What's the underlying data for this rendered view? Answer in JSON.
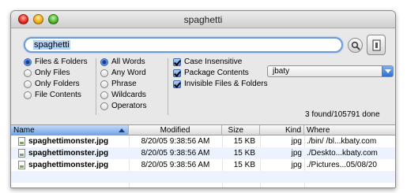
{
  "window": {
    "title": "spaghetti"
  },
  "search": {
    "query": "spaghetti"
  },
  "scope_options": [
    {
      "label": "Files & Folders",
      "selected": true
    },
    {
      "label": "Only Files",
      "selected": false
    },
    {
      "label": "Only Folders",
      "selected": false
    },
    {
      "label": "File Contents",
      "selected": false
    }
  ],
  "match_options": [
    {
      "label": "All Words",
      "selected": true
    },
    {
      "label": "Any Word",
      "selected": false
    },
    {
      "label": "Phrase",
      "selected": false
    },
    {
      "label": "Wildcards",
      "selected": false
    },
    {
      "label": "Operators",
      "selected": false
    }
  ],
  "flags": [
    {
      "label": "Case Insensitive",
      "checked": true
    },
    {
      "label": "Package Contents",
      "checked": true
    },
    {
      "label": "Invisible Files & Folders",
      "checked": true
    }
  ],
  "user_select": {
    "value": "jbaty"
  },
  "status": "3 found/105791 done",
  "table": {
    "columns": [
      "Name",
      "Modified",
      "Size",
      "Kind",
      "Where"
    ],
    "rows": [
      [
        "spaghettimonster.jpg",
        "8/20/05 9:38:56 AM",
        "15 KB",
        "jpg",
        "./bin/ /bl...kbaty.com"
      ],
      [
        "spaghettimonster.jpg",
        "8/20/05 9:38:56 AM",
        "15 KB",
        "jpg",
        "./Deskto...kbaty.com"
      ],
      [
        "spaghettimonster.jpg",
        "8/20/05 9:38:56 AM",
        "15 KB",
        "jpg",
        "./Pictures...05/08/20"
      ]
    ]
  },
  "colors": {
    "accent": "#4f8be2",
    "selection": "#b5d3f7",
    "row_alt": "#edf3fe"
  }
}
